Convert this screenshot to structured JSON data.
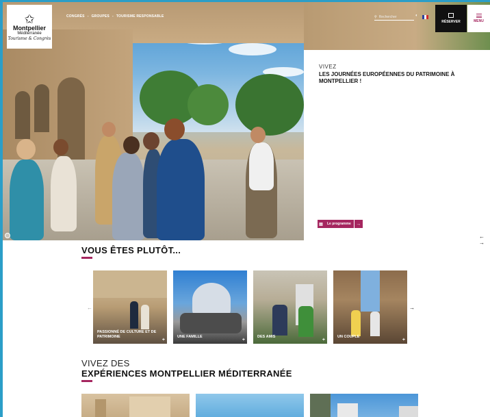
{
  "header": {
    "logo": {
      "line1": "Montpellier",
      "line2": "Méditerranée",
      "line3": "Tourisme & Congrès"
    },
    "nav": [
      "CONGRÈS",
      "-",
      "GROUPES",
      "-",
      "TOURISME RESPONSABLE"
    ],
    "search": {
      "placeholder": "Rechercher"
    },
    "reserve_label": "RÉSERVER",
    "menu_label": "MENU",
    "flag_colors": [
      "#2a3f9d",
      "#ffffff",
      "#d22a2a"
    ]
  },
  "hero": {
    "kicker": "VIVEZ",
    "title": "LES JOURNÉES EUROPÉENNES DU PATRIMOINE À MONTPELLIER !",
    "button_label": "Le programme",
    "slider_arrows": "← →"
  },
  "profiles": {
    "title": "VOUS ÊTES PLUTÔT...",
    "cards": [
      {
        "label": "PASSIONNÉ DE CULTURE ET DE PATRIMOINE"
      },
      {
        "label": "UNE FAMILLE"
      },
      {
        "label": "DES AMIS"
      },
      {
        "label": "UN COUPLE"
      }
    ],
    "prev_arrow": "←",
    "next_arrow": "→"
  },
  "experiences": {
    "subtitle": "VIVEZ DES",
    "title": "EXPÉRIENCES MONTPELLIER MÉDITERRANÉE"
  },
  "colors": {
    "accent": "#a5265f",
    "dark": "#111111",
    "border": "#2b9ec8"
  }
}
